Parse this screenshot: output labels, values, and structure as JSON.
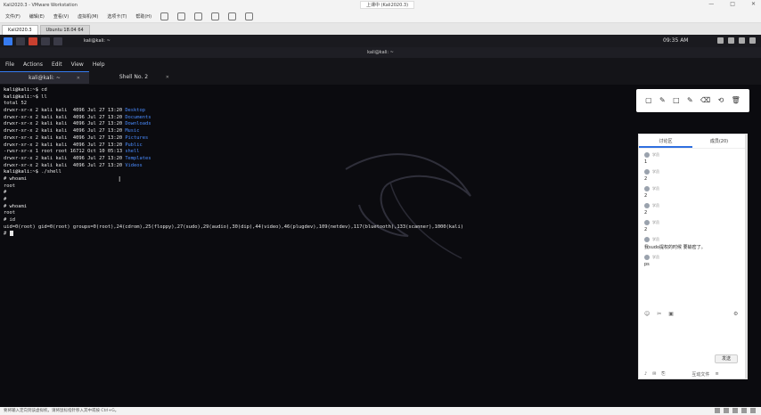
{
  "window": {
    "title": "Kali2020.3 - VMware Workstation",
    "share_badge": "上课中 (Kali2020.3)",
    "controls": [
      "—",
      "□",
      "✕"
    ]
  },
  "vmware_menu": [
    "文件(F)",
    "编辑(E)",
    "查看(V)",
    "虚拟机(M)",
    "选项卡(T)",
    "帮助(H)"
  ],
  "vm_tabs": [
    {
      "label": "Kali2020.3",
      "active": true
    },
    {
      "label": "Ubuntu 18.04 64",
      "active": false
    }
  ],
  "kali_panel": {
    "task_label": "kali@kali: ~",
    "clock": "09:35 AM"
  },
  "terminal": {
    "title": "kali@kali: ~",
    "menu": [
      "File",
      "Actions",
      "Edit",
      "View",
      "Help"
    ],
    "tabs": [
      {
        "label": "kali@kali: ~",
        "active": true
      },
      {
        "label": "Shell No. 2",
        "active": false
      }
    ],
    "lines": [
      {
        "prompt": "kali@kali:~$ ",
        "cmd": "cd"
      },
      {
        "prompt": "kali@kali:~$ ",
        "cmd": "ll"
      },
      {
        "text": "total 52"
      },
      {
        "text": "drwxr-xr-x 2 kali kali  4096 Jul 27 13:20 ",
        "file": "Desktop"
      },
      {
        "text": "drwxr-xr-x 2 kali kali  4096 Jul 27 13:20 ",
        "file": "Documents"
      },
      {
        "text": "drwxr-xr-x 2 kali kali  4096 Jul 27 13:20 ",
        "file": "Downloads"
      },
      {
        "text": "drwxr-xr-x 2 kali kali  4096 Jul 27 13:20 ",
        "file": "Music"
      },
      {
        "text": "drwxr-xr-x 2 kali kali  4096 Jul 27 13:20 ",
        "file": "Pictures"
      },
      {
        "text": "drwxr-xr-x 2 kali kali  4096 Jul 27 13:20 ",
        "file": "Public"
      },
      {
        "text": "-rwsr-xr-x 1 root root 16712 Oct 10 05:13 ",
        "file": "shell"
      },
      {
        "text": "drwxr-xr-x 2 kali kali  4096 Jul 27 13:20 ",
        "file": "Templates"
      },
      {
        "text": "drwxr-xr-x 2 kali kali  4096 Jul 27 13:20 ",
        "file": "Videos"
      },
      {
        "prompt": "kali@kali:~$ ",
        "cmd": "./shell"
      },
      {
        "text": "# whoami"
      },
      {
        "text": "root"
      },
      {
        "text": "#"
      },
      {
        "text": "#"
      },
      {
        "text": "# whoami"
      },
      {
        "text": "root"
      },
      {
        "text": "# id"
      },
      {
        "text": "uid=0(root) gid=0(root) groups=0(root),24(cdrom),25(floppy),27(sudo),29(audio),30(dip),44(video),46(plugdev),109(netdev),117(bluetooth),133(scanner),1000(kali)"
      },
      {
        "text": "# ",
        "cursor": true
      }
    ]
  },
  "annotation_toolbar": [
    "▢",
    "✎",
    "□",
    "✎",
    "⌫",
    "⟲",
    "🗑"
  ],
  "chat": {
    "tabs": [
      "讨论区",
      "成员(20)"
    ],
    "messages": [
      {
        "user": "学员",
        "text": "1"
      },
      {
        "user": "学员",
        "text": "2"
      },
      {
        "user": "学员",
        "text": "2"
      },
      {
        "user": "学员",
        "text": "2"
      },
      {
        "user": "学员",
        "text": "2"
      },
      {
        "user": "学员",
        "text": "我sudo提权的时候  要输密了。"
      },
      {
        "user": "学员",
        "text": "ps"
      }
    ],
    "send_label": "发送",
    "bottom_label": "互动文件"
  },
  "statusbar": {
    "text": "要将输入定向到该虚拟机，请将鼠标指针移入其中或按 Ctrl+G。"
  }
}
